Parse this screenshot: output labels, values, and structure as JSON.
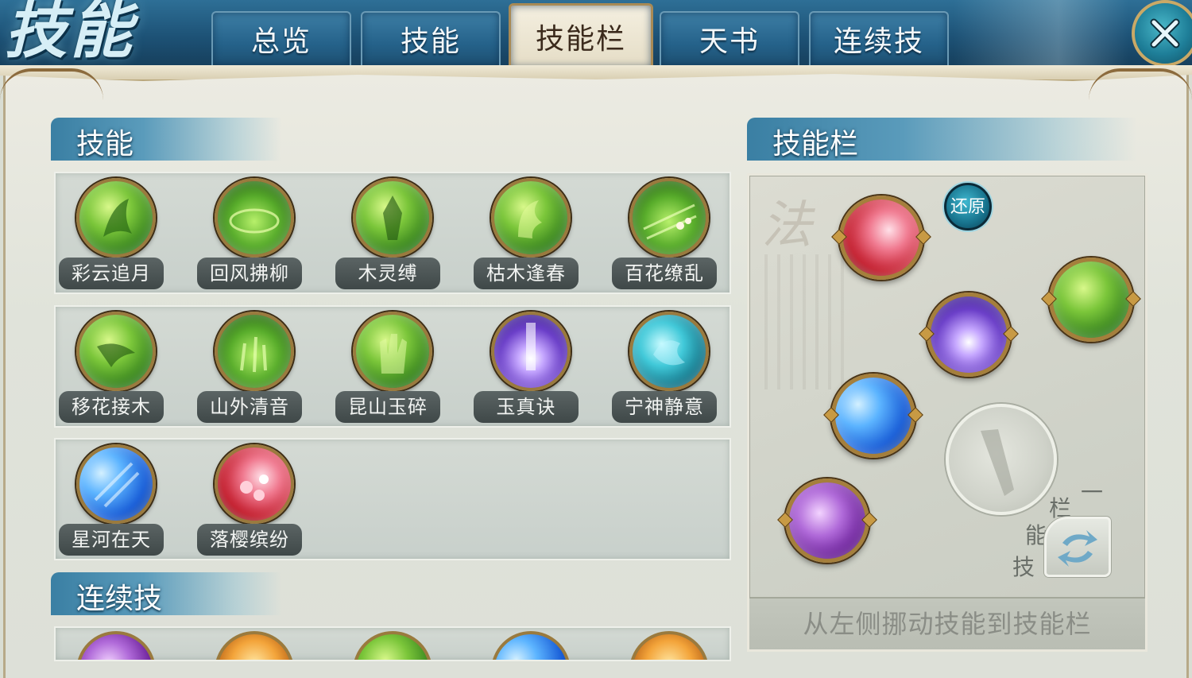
{
  "header": {
    "title_art": "技能",
    "tabs": [
      {
        "label": "总览",
        "active": false
      },
      {
        "label": "技能",
        "active": false
      },
      {
        "label": "技能栏",
        "active": true
      },
      {
        "label": "天书",
        "active": false
      },
      {
        "label": "连续技",
        "active": false
      }
    ],
    "close_icon": "close-x-icon"
  },
  "skills_section": {
    "title": "技能",
    "rows": [
      [
        {
          "name": "彩云追月",
          "color": "green"
        },
        {
          "name": "回风拂柳",
          "color": "green"
        },
        {
          "name": "木灵缚",
          "color": "green"
        },
        {
          "name": "枯木逢春",
          "color": "green"
        },
        {
          "name": "百花缭乱",
          "color": "green"
        }
      ],
      [
        {
          "name": "移花接木",
          "color": "green"
        },
        {
          "name": "山外清音",
          "color": "green"
        },
        {
          "name": "昆山玉碎",
          "color": "green"
        },
        {
          "name": "玉真诀",
          "color": "purple"
        },
        {
          "name": "宁神静意",
          "color": "teal"
        }
      ],
      [
        {
          "name": "星河在天",
          "color": "blue"
        },
        {
          "name": "落樱缤纷",
          "color": "red"
        }
      ]
    ]
  },
  "combo_section": {
    "title": "连续技"
  },
  "skillbar_section": {
    "title": "技能栏",
    "restore_label": "还原",
    "switch_label_chars": [
      "技",
      "能",
      "栏"
    ],
    "switch_suffix": "一",
    "hint": "从左侧挪动技能到技能栏",
    "watermark_char": "法"
  },
  "colors": {
    "accent_blue": "#2e6f96",
    "gold_border": "#a57f3c",
    "paper": "#e0e3da"
  }
}
